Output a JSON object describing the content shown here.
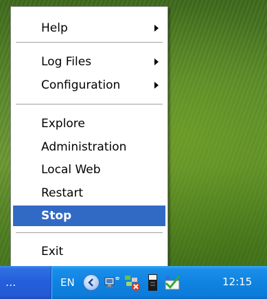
{
  "menu": {
    "items": [
      {
        "label": "Help",
        "submenu": true
      },
      {
        "label": "Log Files",
        "submenu": true
      },
      {
        "label": "Configuration",
        "submenu": true
      },
      {
        "label": "Explore",
        "submenu": false
      },
      {
        "label": "Administration",
        "submenu": false
      },
      {
        "label": "Local Web",
        "submenu": false
      },
      {
        "label": "Restart",
        "submenu": false
      },
      {
        "label": "Stop",
        "submenu": false,
        "selected": true
      },
      {
        "label": "Exit",
        "submenu": false
      }
    ],
    "highlight_color": "#316ac5"
  },
  "taskbar": {
    "truncated_text": "...",
    "language": "EN",
    "clock": "12:15",
    "tray_icons": [
      "show-hidden-icons-chevron",
      "network-wireless-icon",
      "network-error-icon",
      "application-server-icon",
      "scheduler-check-icon"
    ],
    "color": "#245edb"
  }
}
